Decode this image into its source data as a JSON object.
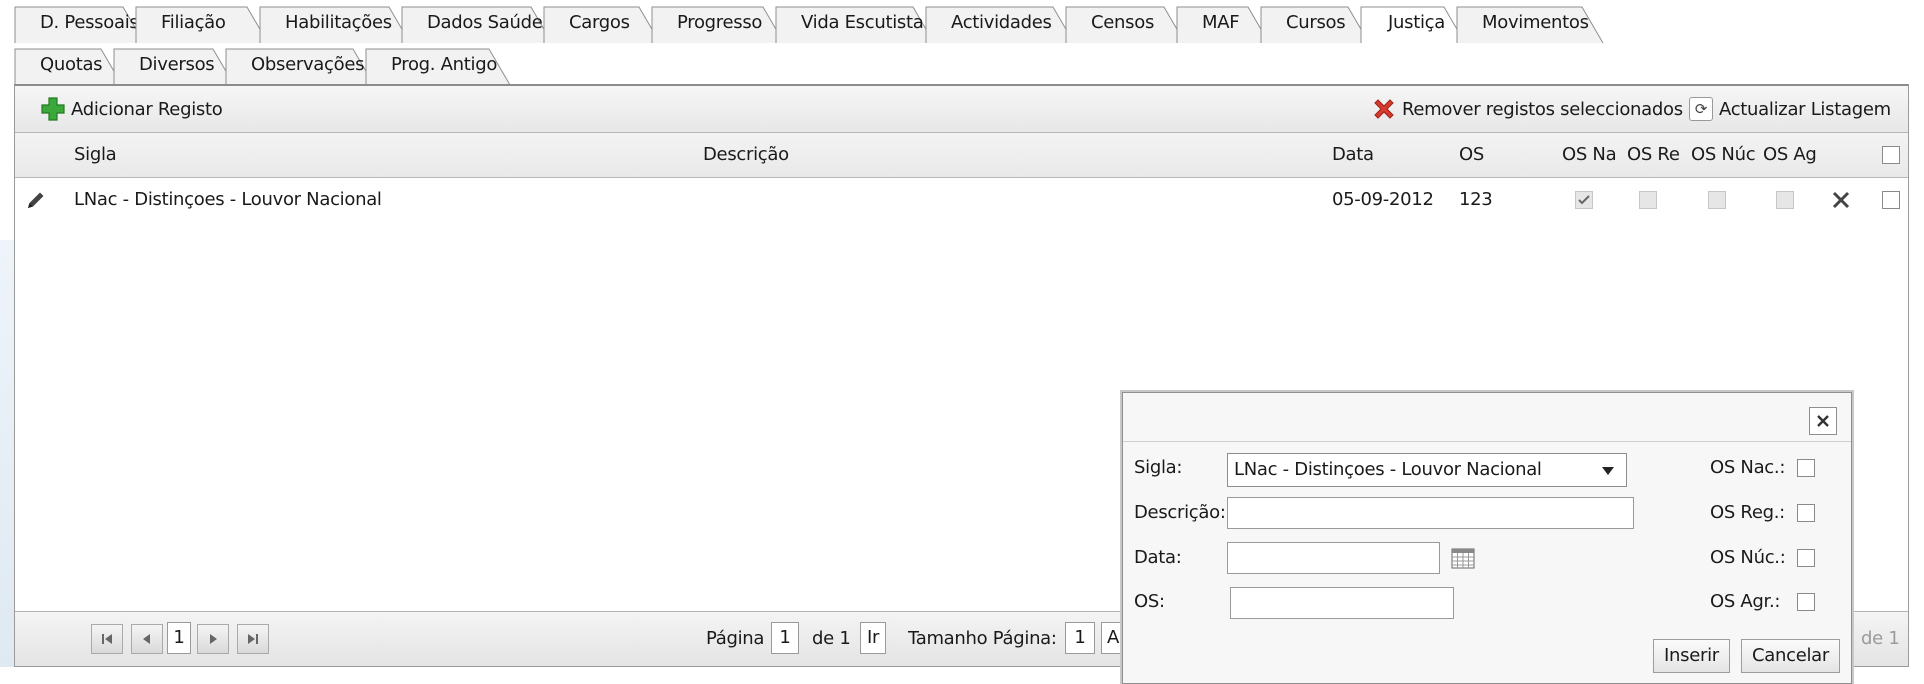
{
  "tabs_row1": [
    "D. Pessoais",
    "Filiação",
    "Habilitações",
    "Dados Saúde",
    "Cargos",
    "Progresso",
    "Vida Escutista",
    "Actividades",
    "Censos",
    "MAF",
    "Cursos",
    "Justiça",
    "Movimentos"
  ],
  "tabs_row2": [
    "Quotas",
    "Diversos",
    "Observações",
    "Prog. Antigo"
  ],
  "active_tab": "Justiça",
  "toolbar": {
    "add_label": "Adicionar Registo",
    "remove_label": "Remover registos seleccionados",
    "refresh_label": "Actualizar Listagem",
    "add_icon": "plus-icon",
    "remove_icon": "red-x-icon",
    "refresh_icon": "refresh-icon"
  },
  "table": {
    "headers": {
      "sigla": "Sigla",
      "descricao": "Descrição",
      "data": "Data",
      "os": "OS",
      "os_nac": "OS Na",
      "os_reg": "OS Re",
      "os_nuc": "OS Núc",
      "os_agr": "OS Ag"
    },
    "rows": [
      {
        "sigla": "LNac - Distinçoes - Louvor Nacional",
        "descricao": "",
        "data": "05-09-2012",
        "os": "123",
        "os_nac": true,
        "os_reg": false,
        "os_nuc": false,
        "os_agr": false
      }
    ]
  },
  "pager": {
    "current_page": "1",
    "pagina_label": "Página",
    "page_input": "1",
    "of_label": "de 1",
    "go_label": "Ir",
    "page_size_label": "Tamanho Página:",
    "page_size": "1",
    "trailing": "A",
    "right_info": "de 1"
  },
  "dialog": {
    "close_icon": "close-icon",
    "sigla_label": "Sigla:",
    "sigla_value": "LNac - Distinçoes - Louvor Nacional",
    "descricao_label": "Descrição:",
    "data_label": "Data:",
    "os_label": "OS:",
    "os_nac_label": "OS Nac.:",
    "os_reg_label": "OS Reg.:",
    "os_nuc_label": "OS Núc.:",
    "os_agr_label": "OS Agr.:",
    "insert_label": "Inserir",
    "cancel_label": "Cancelar"
  },
  "colors": {
    "panel_border": "#8c8c8c",
    "remove_red": "#d83a2e",
    "add_green": "#3aa83a"
  }
}
